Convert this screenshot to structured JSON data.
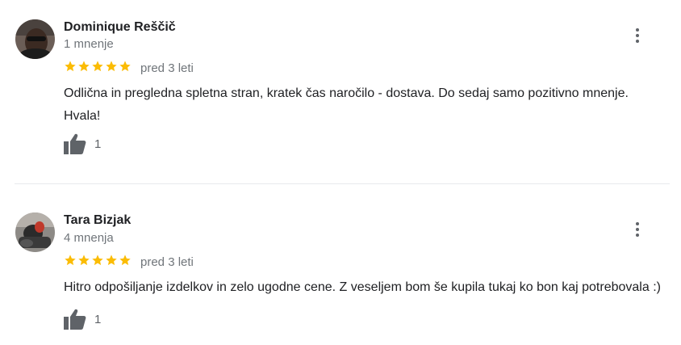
{
  "colors": {
    "star": "#fbbc04",
    "secondary_text": "#70757a",
    "icon": "#5f6368",
    "divider": "#e8eaed"
  },
  "reviews": [
    {
      "author": "Dominique Reščič",
      "review_count": "1 mnenje",
      "rating": 5,
      "date": "pred 3 leti",
      "text": "Odlična in pregledna spletna stran, kratek čas naročilo - dostava. Do sedaj samo pozitivno mnenje. Hvala!",
      "likes": "1",
      "like_icon": "thumbs-up-icon",
      "menu_icon": "more-vert-icon"
    },
    {
      "author": "Tara Bizjak",
      "review_count": "4 mnenja",
      "rating": 5,
      "date": "pred 3 leti",
      "text": "Hitro odpošiljanje izdelkov in zelo ugodne cene. Z veseljem bom še kupila tukaj ko bon kaj potrebovala :)",
      "likes": "1",
      "like_icon": "thumbs-up-icon",
      "menu_icon": "more-vert-icon"
    }
  ]
}
